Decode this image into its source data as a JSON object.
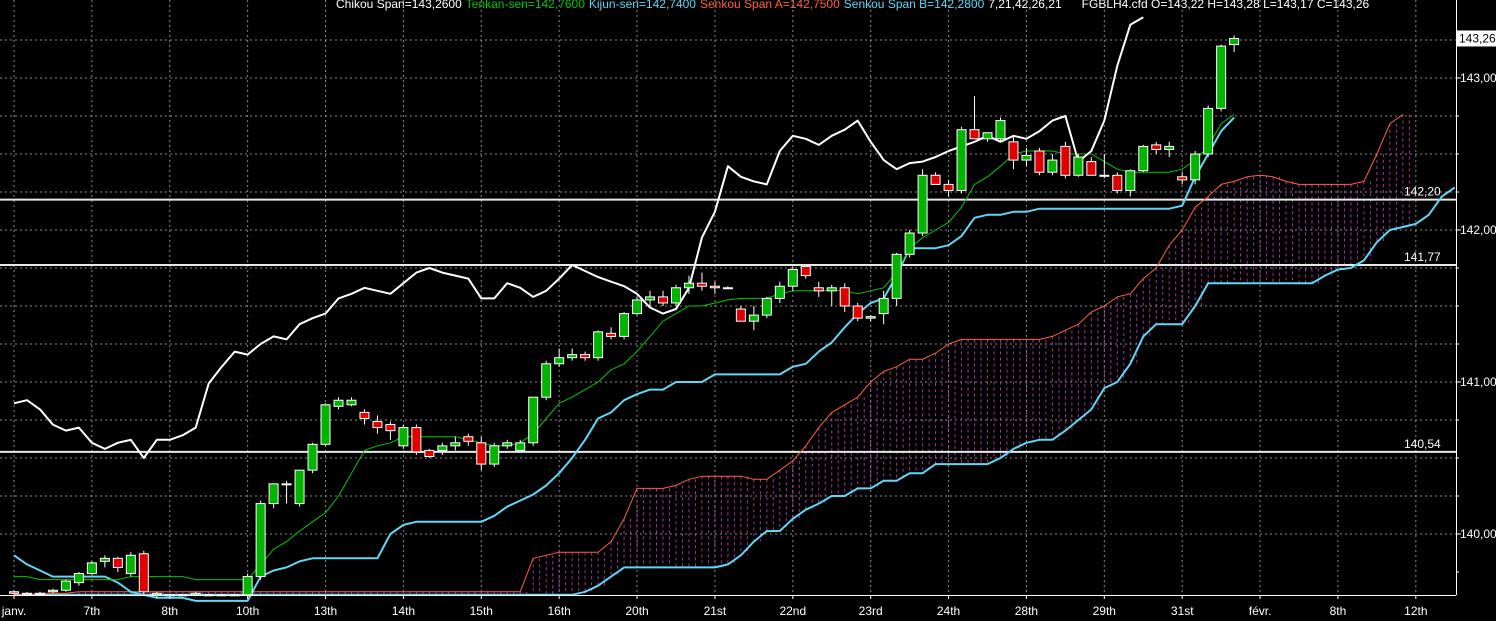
{
  "header": {
    "chikou": "Chikou Span=143,2600",
    "tenkan": "Tenkan-sen=142,7600",
    "kijun": "Kijun-sen=142,7400",
    "senkou_a": "Senkou Span A=142,7500",
    "senkou_b": "Senkou Span B=142,2800",
    "params": "7,21,42,26,21",
    "symbol_ohlc": "FGBLH4.cfd O=143,22 H=143,28 L=143,17 C=143,26"
  },
  "colors": {
    "background": "#000000",
    "up_candle": "#00b400",
    "down_candle": "#e00000",
    "chikou": "#ffffff",
    "tenkan": "#00c800",
    "kijun": "#5fd7f5",
    "senkou_a": "#ff6040",
    "senkou_b": "#5fd7f5",
    "cloud_fill": "#c040c0",
    "grid": "#8a8a8a"
  },
  "chart_data": {
    "type": "candlestick",
    "indicator": "Ichimoku",
    "y_axis_ticks": [
      "143,00",
      "142,00",
      "141,00",
      "140,00"
    ],
    "y_tick_values": [
      143.0,
      142.0,
      141.0,
      140.0
    ],
    "ylim": [
      139.65,
      143.5
    ],
    "x_axis_labels": [
      "janv.",
      "7th",
      "8th",
      "10th",
      "13th",
      "14th",
      "15th",
      "16th",
      "20th",
      "21st",
      "22nd",
      "23rd",
      "24th",
      "28th",
      "29th",
      "31st",
      "févr.",
      "8th",
      "12th"
    ],
    "x_label_slots": [
      0,
      6,
      12,
      18,
      24,
      30,
      36,
      42,
      48,
      54,
      60,
      66,
      72,
      78,
      84,
      90,
      96,
      102,
      108
    ],
    "last_price": {
      "label": "143,26",
      "value": 143.26
    },
    "horizontal_levels": [
      {
        "label": "142,20",
        "value": 142.2
      },
      {
        "label": "141,77",
        "value": 141.77
      },
      {
        "label": "140,54",
        "value": 140.54
      }
    ],
    "candles": [
      [
        139.62,
        139.63,
        139.6,
        139.61
      ],
      [
        139.61,
        139.62,
        139.6,
        139.61
      ],
      [
        139.61,
        139.62,
        139.6,
        139.61
      ],
      [
        139.62,
        139.64,
        139.61,
        139.63
      ],
      [
        139.63,
        139.7,
        139.62,
        139.69
      ],
      [
        139.68,
        139.75,
        139.66,
        139.74
      ],
      [
        139.74,
        139.82,
        139.73,
        139.81
      ],
      [
        139.82,
        139.86,
        139.78,
        139.84
      ],
      [
        139.84,
        139.85,
        139.75,
        139.78
      ],
      [
        139.74,
        139.88,
        139.72,
        139.86
      ],
      [
        139.87,
        139.89,
        139.6,
        139.62
      ],
      [
        139.6,
        139.62,
        139.58,
        139.61
      ],
      [
        139.6,
        139.6,
        139.6,
        139.6
      ],
      [
        139.6,
        139.6,
        139.6,
        139.6
      ],
      [
        139.6,
        139.62,
        139.59,
        139.61
      ],
      [
        139.6,
        139.6,
        139.6,
        139.6
      ],
      [
        139.6,
        139.6,
        139.6,
        139.6
      ],
      [
        139.6,
        139.6,
        139.6,
        139.6
      ],
      [
        139.6,
        139.74,
        139.58,
        139.72
      ],
      [
        139.72,
        140.22,
        139.7,
        140.2
      ],
      [
        140.2,
        140.33,
        140.17,
        140.33
      ],
      [
        140.33,
        140.35,
        140.2,
        140.33
      ],
      [
        140.2,
        140.42,
        140.18,
        140.42
      ],
      [
        140.42,
        140.6,
        140.4,
        140.59
      ],
      [
        140.59,
        140.86,
        140.58,
        140.85
      ],
      [
        140.84,
        140.9,
        140.82,
        140.88
      ],
      [
        140.85,
        140.9,
        140.84,
        140.88
      ],
      [
        140.8,
        140.82,
        140.72,
        140.76
      ],
      [
        140.74,
        140.78,
        140.66,
        140.7
      ],
      [
        140.72,
        140.74,
        140.62,
        140.68
      ],
      [
        140.58,
        140.72,
        140.56,
        140.7
      ],
      [
        140.7,
        140.72,
        140.52,
        140.54
      ],
      [
        140.55,
        140.56,
        140.5,
        140.51
      ],
      [
        140.55,
        140.6,
        140.52,
        140.58
      ],
      [
        140.58,
        140.64,
        140.55,
        140.6
      ],
      [
        140.64,
        140.66,
        140.58,
        140.61
      ],
      [
        140.6,
        140.64,
        140.42,
        140.46
      ],
      [
        140.46,
        140.6,
        140.44,
        140.58
      ],
      [
        140.58,
        140.62,
        140.56,
        140.6
      ],
      [
        140.55,
        140.62,
        140.54,
        140.6
      ],
      [
        140.6,
        140.9,
        140.58,
        140.9
      ],
      [
        140.9,
        141.14,
        140.88,
        141.12
      ],
      [
        141.12,
        141.22,
        141.1,
        141.16
      ],
      [
        141.16,
        141.22,
        141.14,
        141.18
      ],
      [
        141.18,
        141.2,
        141.14,
        141.16
      ],
      [
        141.16,
        141.34,
        141.14,
        141.33
      ],
      [
        141.32,
        141.36,
        141.28,
        141.3
      ],
      [
        141.3,
        141.46,
        141.28,
        141.45
      ],
      [
        141.45,
        141.56,
        141.44,
        141.54
      ],
      [
        141.54,
        141.6,
        141.5,
        141.56
      ],
      [
        141.56,
        141.6,
        141.5,
        141.52
      ],
      [
        141.52,
        141.64,
        141.5,
        141.62
      ],
      [
        141.62,
        141.7,
        141.58,
        141.65
      ],
      [
        141.65,
        141.72,
        141.6,
        141.63
      ],
      [
        141.63,
        141.66,
        141.58,
        141.62
      ],
      [
        141.62,
        141.63,
        141.61,
        141.62
      ],
      [
        141.48,
        141.5,
        141.4,
        141.4
      ],
      [
        141.4,
        141.5,
        141.34,
        141.44
      ],
      [
        141.44,
        141.56,
        141.42,
        141.55
      ],
      [
        141.55,
        141.66,
        141.52,
        141.63
      ],
      [
        141.63,
        141.76,
        141.6,
        141.74
      ],
      [
        141.76,
        141.76,
        141.68,
        141.7
      ],
      [
        141.62,
        141.66,
        141.56,
        141.6
      ],
      [
        141.6,
        141.64,
        141.5,
        141.62
      ],
      [
        141.62,
        141.65,
        141.46,
        141.5
      ],
      [
        141.5,
        141.52,
        141.4,
        141.42
      ],
      [
        141.42,
        141.44,
        141.4,
        141.43
      ],
      [
        141.45,
        141.6,
        141.38,
        141.55
      ],
      [
        141.55,
        141.85,
        141.5,
        141.84
      ],
      [
        141.84,
        142.0,
        141.82,
        141.98
      ],
      [
        141.98,
        142.4,
        141.96,
        142.36
      ],
      [
        142.36,
        142.38,
        142.34,
        142.3
      ],
      [
        142.3,
        142.33,
        142.22,
        142.26
      ],
      [
        142.26,
        142.68,
        142.24,
        142.66
      ],
      [
        142.66,
        142.88,
        142.6,
        142.6
      ],
      [
        142.6,
        142.64,
        142.58,
        142.64
      ],
      [
        142.6,
        142.74,
        142.58,
        142.72
      ],
      [
        142.58,
        142.62,
        142.4,
        142.46
      ],
      [
        142.46,
        142.54,
        142.42,
        142.49
      ],
      [
        142.52,
        142.54,
        142.36,
        142.38
      ],
      [
        142.38,
        142.5,
        142.36,
        142.46
      ],
      [
        142.55,
        142.58,
        142.34,
        142.36
      ],
      [
        142.36,
        142.5,
        142.35,
        142.48
      ],
      [
        142.45,
        142.48,
        142.38,
        142.36
      ],
      [
        142.36,
        142.5,
        142.34,
        142.36
      ],
      [
        142.36,
        142.38,
        142.24,
        142.26
      ],
      [
        142.26,
        142.4,
        142.22,
        142.39
      ],
      [
        142.39,
        142.56,
        142.38,
        142.55
      ],
      [
        142.56,
        142.58,
        142.5,
        142.53
      ],
      [
        142.53,
        142.58,
        142.48,
        142.55
      ],
      [
        142.35,
        142.38,
        142.3,
        142.33
      ],
      [
        142.33,
        142.52,
        142.3,
        142.5
      ],
      [
        142.5,
        142.82,
        142.48,
        142.8
      ],
      [
        142.8,
        143.22,
        142.78,
        143.21
      ],
      [
        143.22,
        143.28,
        143.17,
        143.26
      ]
    ],
    "tenkan": [
      139.72,
      139.72,
      139.7,
      139.7,
      139.7,
      139.7,
      139.7,
      139.7,
      139.7,
      139.72,
      139.72,
      139.72,
      139.72,
      139.72,
      139.7,
      139.7,
      139.7,
      139.7,
      139.7,
      139.8,
      139.9,
      139.95,
      140.02,
      140.08,
      140.14,
      140.25,
      140.4,
      140.55,
      140.58,
      140.6,
      140.64,
      140.64,
      140.64,
      140.64,
      140.64,
      140.62,
      140.6,
      140.58,
      140.58,
      140.6,
      140.66,
      140.76,
      140.86,
      140.9,
      140.95,
      141.0,
      141.08,
      141.12,
      141.2,
      141.3,
      141.4,
      141.45,
      141.5,
      141.5,
      141.52,
      141.54,
      141.55,
      141.55,
      141.55,
      141.58,
      141.6,
      141.6,
      141.6,
      141.6,
      141.6,
      141.58,
      141.6,
      141.62,
      141.72,
      141.88,
      141.95,
      142.0,
      142.05,
      142.15,
      142.3,
      142.35,
      142.42,
      142.5,
      142.52,
      142.52,
      142.52,
      142.5,
      142.5,
      142.5,
      142.45,
      142.4,
      142.38,
      142.38,
      142.38,
      142.38,
      142.4,
      142.46,
      142.55,
      142.7,
      142.76
    ],
    "kijun": [
      139.86,
      139.8,
      139.76,
      139.72,
      139.72,
      139.72,
      139.72,
      139.72,
      139.68,
      139.62,
      139.6,
      139.58,
      139.58,
      139.58,
      139.56,
      139.56,
      139.56,
      139.56,
      139.56,
      139.72,
      139.76,
      139.78,
      139.82,
      139.84,
      139.84,
      139.84,
      139.84,
      139.84,
      139.84,
      140.0,
      140.06,
      140.08,
      140.08,
      140.08,
      140.08,
      140.08,
      140.08,
      140.12,
      140.18,
      140.22,
      140.26,
      140.32,
      140.4,
      140.5,
      140.62,
      140.76,
      140.8,
      140.88,
      140.92,
      140.95,
      140.95,
      141.0,
      141.0,
      141.0,
      141.05,
      141.05,
      141.05,
      141.05,
      141.05,
      141.05,
      141.1,
      141.12,
      141.2,
      141.26,
      141.36,
      141.45,
      141.52,
      141.55,
      141.7,
      141.88,
      141.88,
      141.88,
      141.9,
      141.96,
      142.08,
      142.1,
      142.1,
      142.12,
      142.12,
      142.14,
      142.14,
      142.14,
      142.14,
      142.14,
      142.14,
      142.14,
      142.14,
      142.14,
      142.14,
      142.14,
      142.16,
      142.35,
      142.5,
      142.65,
      142.74
    ],
    "chikou": [
      140.86,
      140.88,
      140.82,
      140.72,
      140.68,
      140.7,
      140.6,
      140.56,
      140.6,
      140.62,
      140.5,
      140.62,
      140.62,
      140.65,
      140.7,
      140.99,
      141.1,
      141.2,
      141.18,
      141.25,
      141.3,
      141.28,
      141.38,
      141.42,
      141.45,
      141.55,
      141.58,
      141.62,
      141.6,
      141.58,
      141.65,
      141.72,
      141.75,
      141.72,
      141.7,
      141.68,
      141.55,
      141.55,
      141.65,
      141.62,
      141.56,
      141.6,
      141.68,
      141.77,
      141.73,
      141.69,
      141.66,
      141.63,
      141.58,
      141.49,
      141.45,
      141.48,
      141.62,
      141.95,
      142.12,
      142.42,
      142.35,
      142.32,
      142.3,
      142.52,
      142.62,
      142.6,
      142.56,
      142.62,
      142.66,
      142.72,
      142.58,
      142.46,
      142.4,
      142.44,
      142.45,
      142.48,
      142.52,
      142.55,
      142.58,
      142.62,
      142.58,
      142.62,
      142.6,
      142.65,
      142.72,
      142.75,
      142.45,
      142.52,
      142.72,
      143.08,
      143.35,
      143.4
    ],
    "senkou_a": [
      139.6,
      139.6,
      139.61,
      139.61,
      139.61,
      139.62,
      139.62,
      139.62,
      139.62,
      139.62,
      139.62,
      139.62,
      139.62,
      139.62,
      139.62,
      139.62,
      139.62,
      139.62,
      139.62,
      139.62,
      139.62,
      139.62,
      139.62,
      139.62,
      139.62,
      139.62,
      139.62,
      139.62,
      139.62,
      139.62,
      139.62,
      139.62,
      139.62,
      139.62,
      139.62,
      139.62,
      139.62,
      139.62,
      139.62,
      139.62,
      139.84,
      139.86,
      139.88,
      139.88,
      139.88,
      139.88,
      139.95,
      140.1,
      140.3,
      140.3,
      140.3,
      140.32,
      140.36,
      140.38,
      140.38,
      140.38,
      140.38,
      140.36,
      140.36,
      140.42,
      140.48,
      140.58,
      140.7,
      140.8,
      140.85,
      140.9,
      141.0,
      141.07,
      141.1,
      141.15,
      141.15,
      141.19,
      141.25,
      141.28,
      141.28,
      141.28,
      141.28,
      141.28,
      141.28,
      141.28,
      141.3,
      141.34,
      141.38,
      141.46,
      141.5,
      141.56,
      141.58,
      141.68,
      141.75,
      141.9,
      142.0,
      142.15,
      142.22,
      142.3,
      142.32,
      142.35,
      142.36,
      142.35,
      142.32,
      142.3,
      142.3,
      142.3,
      142.3,
      142.3,
      142.32,
      142.5,
      142.7,
      142.76
    ],
    "senkou_b": [
      139.6,
      139.6,
      139.6,
      139.6,
      139.6,
      139.6,
      139.6,
      139.6,
      139.6,
      139.6,
      139.6,
      139.6,
      139.6,
      139.6,
      139.6,
      139.6,
      139.6,
      139.6,
      139.6,
      139.6,
      139.6,
      139.6,
      139.6,
      139.6,
      139.6,
      139.6,
      139.6,
      139.6,
      139.6,
      139.6,
      139.6,
      139.6,
      139.6,
      139.6,
      139.6,
      139.6,
      139.6,
      139.6,
      139.6,
      139.6,
      139.6,
      139.6,
      139.6,
      139.6,
      139.62,
      139.66,
      139.72,
      139.78,
      139.78,
      139.78,
      139.78,
      139.78,
      139.78,
      139.78,
      139.78,
      139.8,
      139.86,
      139.95,
      140.02,
      140.02,
      140.1,
      140.16,
      140.2,
      140.25,
      140.25,
      140.3,
      140.3,
      140.35,
      140.35,
      140.4,
      140.4,
      140.46,
      140.46,
      140.46,
      140.46,
      140.46,
      140.5,
      140.56,
      140.6,
      140.62,
      140.62,
      140.68,
      140.75,
      140.82,
      140.96,
      141.0,
      141.12,
      141.3,
      141.38,
      141.38,
      141.38,
      141.5,
      141.65,
      141.65,
      141.65,
      141.65,
      141.65,
      141.65,
      141.65,
      141.65,
      141.65,
      141.7,
      141.74,
      141.75,
      141.8,
      141.92,
      142.0,
      142.02,
      142.04,
      142.1,
      142.22,
      142.28
    ]
  }
}
